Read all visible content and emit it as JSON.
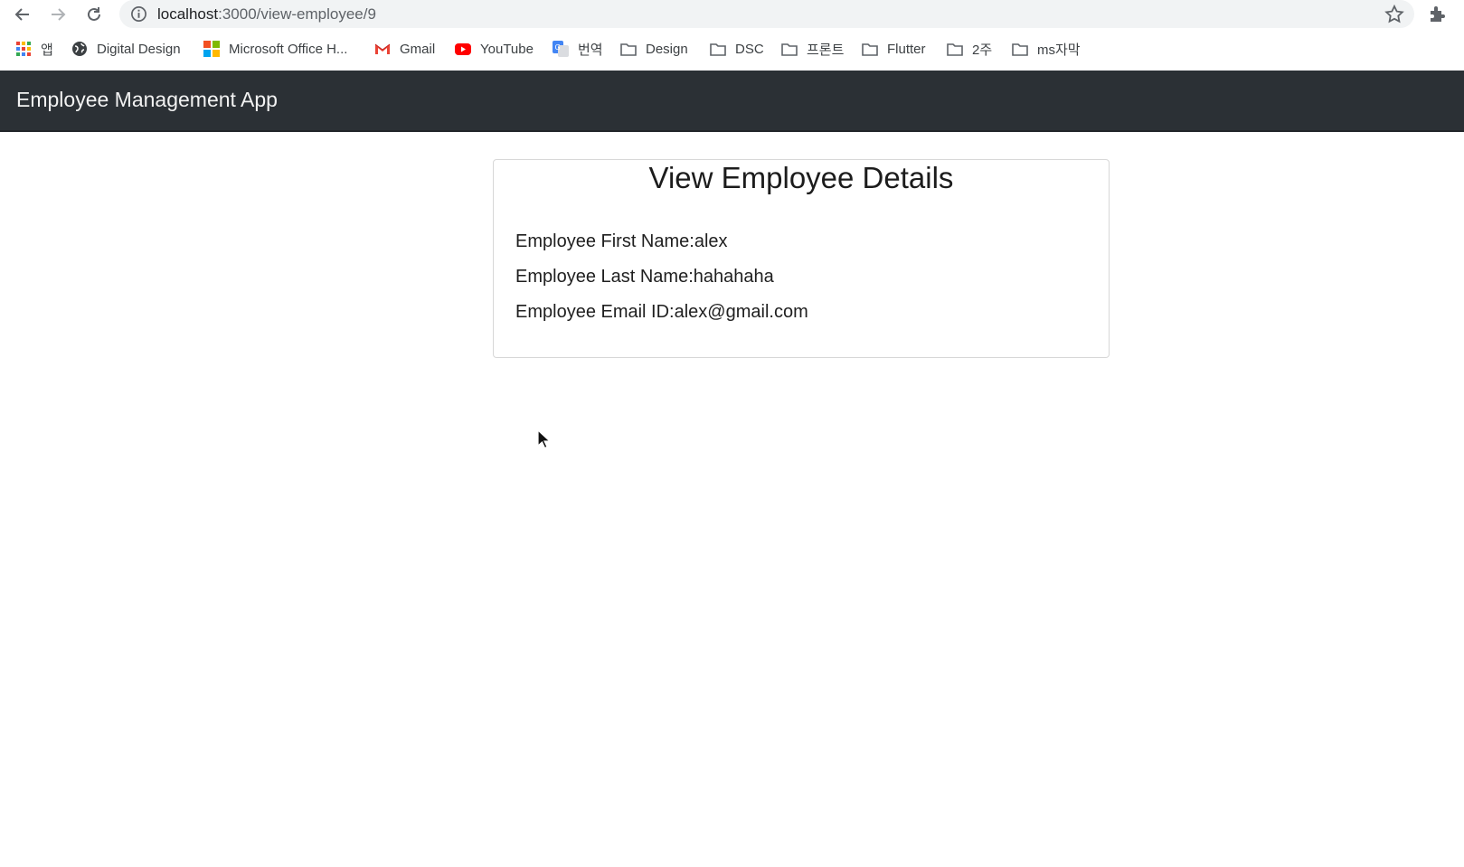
{
  "browser": {
    "url_host": "localhost",
    "url_path": ":3000/view-employee/9",
    "bookmarks": [
      {
        "label": "앱",
        "icon": "apps-grid-icon"
      },
      {
        "label": "Digital Design",
        "icon": "globe-icon"
      },
      {
        "label": "Microsoft Office H...",
        "icon": "microsoft-icon"
      },
      {
        "label": "Gmail",
        "icon": "gmail-icon"
      },
      {
        "label": "YouTube",
        "icon": "youtube-icon"
      },
      {
        "label": "번역",
        "icon": "translate-icon"
      },
      {
        "label": "Design",
        "icon": "folder-icon"
      },
      {
        "label": "DSC",
        "icon": "folder-icon"
      },
      {
        "label": "프론트",
        "icon": "folder-icon"
      },
      {
        "label": "Flutter",
        "icon": "folder-icon"
      },
      {
        "label": "2주",
        "icon": "folder-icon"
      },
      {
        "label": "ms자막",
        "icon": "folder-icon"
      }
    ]
  },
  "navbar": {
    "brand": "Employee Management App",
    "background": "#2b3035"
  },
  "card": {
    "title": "View Employee Details",
    "rows": [
      {
        "text": "Employee First Name:alex"
      },
      {
        "text": "Employee Last Name:hahahaha"
      },
      {
        "text": "Employee Email ID:alex@gmail.com"
      }
    ]
  }
}
